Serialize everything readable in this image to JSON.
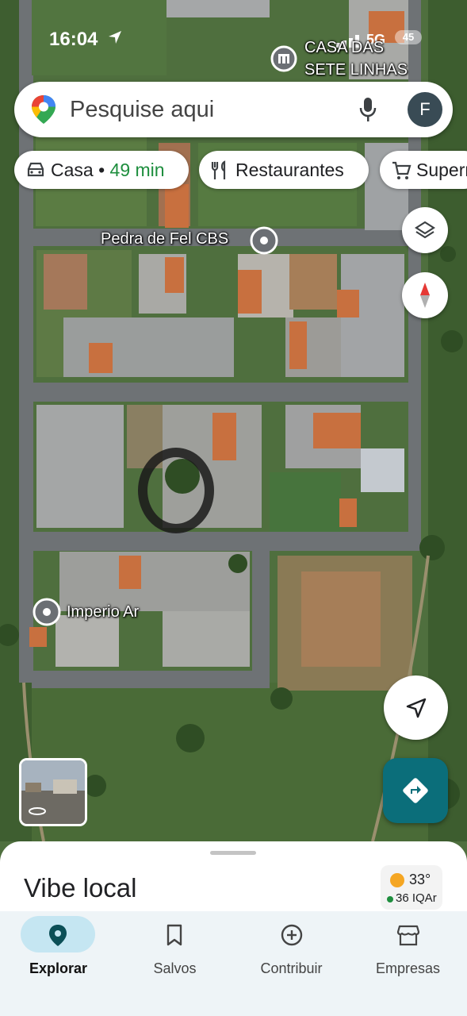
{
  "status_bar": {
    "time": "16:04",
    "network": "5G",
    "battery": "45"
  },
  "search": {
    "placeholder": "Pesquise aqui",
    "avatar_initial": "F",
    "icons": [
      "maps-logo-icon",
      "mic-icon"
    ]
  },
  "chips": [
    {
      "icon": "car-icon",
      "label": "Casa • ",
      "eta": "49 min"
    },
    {
      "icon": "fork-knife-icon",
      "label": "Restaurantes"
    },
    {
      "icon": "cart-icon",
      "label": "Supermercados"
    }
  ],
  "map_labels": [
    {
      "text": "CASA DAS\nSETE LINHAS",
      "icon": "building-pin-icon"
    },
    {
      "text": "Pedra de Fel CBS",
      "icon": "place-pin-icon"
    },
    {
      "text": "Imperio Ar",
      "icon": "place-pin-icon"
    }
  ],
  "map_controls": [
    "layers-icon",
    "compass-icon",
    "my-location-icon",
    "directions-icon",
    "street-view-thumbnail"
  ],
  "sheet": {
    "title": "Vibe local",
    "weather": {
      "temperature": "33°",
      "air_quality": "36 IQAr",
      "icon": "sun-icon"
    }
  },
  "bottom_nav": [
    {
      "label": "Explorar",
      "icon": "explore-pin-icon",
      "active": true
    },
    {
      "label": "Salvos",
      "icon": "bookmark-icon",
      "active": false
    },
    {
      "label": "Contribuir",
      "icon": "add-circle-icon",
      "active": false
    },
    {
      "label": "Empresas",
      "icon": "store-icon",
      "active": false
    }
  ],
  "colors": {
    "accent": "#0b6e7a",
    "eta_green": "#1e8e3e",
    "nav_active": "#c5e6f2"
  }
}
